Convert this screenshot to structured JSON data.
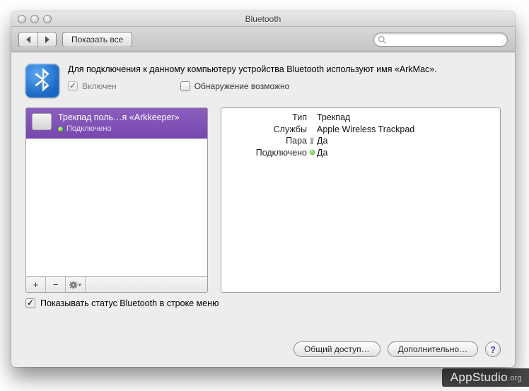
{
  "window": {
    "title": "Bluetooth"
  },
  "toolbar": {
    "show_all": "Показать все",
    "search_placeholder": ""
  },
  "header": {
    "description": "Для подключения к данному компьютеру устройства Bluetooth используют имя «ArkMac».",
    "enabled_label": "Включен",
    "discoverable_label": "Обнаружение возможно",
    "enabled_checked": true,
    "discoverable_checked": false
  },
  "devices": [
    {
      "name": "Трекпад поль…я «Arkkeeper»",
      "status": "Подключено"
    }
  ],
  "details": {
    "type_label": "Тип",
    "type_value": "Трекпад",
    "services_label": "Службы",
    "services_value": "Apple Wireless Trackpad",
    "paired_label": "Пара",
    "paired_value": "Да",
    "connected_label": "Подключено",
    "connected_value": "Да"
  },
  "listbar": {
    "add": "+",
    "remove": "−"
  },
  "status_menu": {
    "label": "Показывать статус Bluetooth в строке меню",
    "checked": true
  },
  "footer": {
    "sharing": "Общий доступ…",
    "advanced": "Дополнительно…"
  },
  "watermark": {
    "brand": "AppStudio",
    "tld": ".org"
  }
}
